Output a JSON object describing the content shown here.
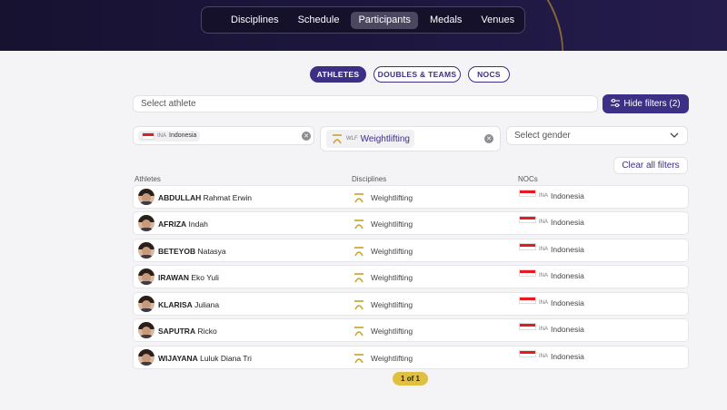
{
  "nav": {
    "items": [
      {
        "label": "Disciplines"
      },
      {
        "label": "Schedule"
      },
      {
        "label": "Participants",
        "active": true
      },
      {
        "label": "Medals"
      },
      {
        "label": "Venues"
      }
    ]
  },
  "tabs": [
    {
      "label": "ATHLETES",
      "active": true
    },
    {
      "label": "DOUBLES & TEAMS"
    },
    {
      "label": "NOCS"
    }
  ],
  "search": {
    "placeholder": "Select athlete"
  },
  "hide_filters_label": "Hide filters (2)",
  "filters": {
    "noc": {
      "code": "INA",
      "label": "Indonesia"
    },
    "discipline": {
      "code": "WLF",
      "label": "Weightlifting"
    },
    "gender_placeholder": "Select gender"
  },
  "clear_all_label": "Clear all filters",
  "table": {
    "headers": {
      "athletes": "Athletes",
      "disciplines": "Disciplines",
      "nocs": "NOCs"
    },
    "rows": [
      {
        "surname": "ABDULLAH",
        "given": "Rahmat Erwin",
        "discipline": "Weightlifting",
        "noc_code": "INA",
        "noc": "Indonesia"
      },
      {
        "surname": "AFRIZA",
        "given": "Indah",
        "discipline": "Weightlifting",
        "noc_code": "INA",
        "noc": "Indonesia"
      },
      {
        "surname": "BETEYOB",
        "given": "Natasya",
        "discipline": "Weightlifting",
        "noc_code": "INA",
        "noc": "Indonesia"
      },
      {
        "surname": "IRAWAN",
        "given": "Eko Yuli",
        "discipline": "Weightlifting",
        "noc_code": "INA",
        "noc": "Indonesia"
      },
      {
        "surname": "KLARISA",
        "given": "Juliana",
        "discipline": "Weightlifting",
        "noc_code": "INA",
        "noc": "Indonesia"
      },
      {
        "surname": "SAPUTRA",
        "given": "Ricko",
        "discipline": "Weightlifting",
        "noc_code": "INA",
        "noc": "Indonesia"
      },
      {
        "surname": "WIJAYANA",
        "given": "Luluk Diana Tri",
        "discipline": "Weightlifting",
        "noc_code": "INA",
        "noc": "Indonesia"
      }
    ]
  },
  "pagination": "1 of 1",
  "colors": {
    "accent": "#3b2f86",
    "gold": "#e0c043",
    "header_bg": "#1d1740"
  }
}
